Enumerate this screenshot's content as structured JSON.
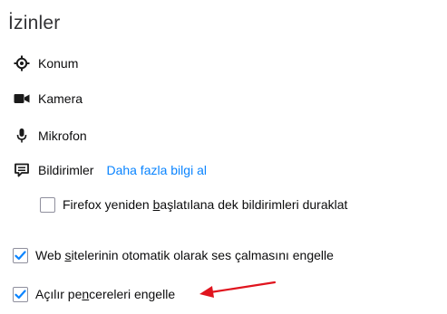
{
  "section": {
    "title": "İzinler"
  },
  "permissions": [
    {
      "label": "Konum",
      "icon": "location-icon"
    },
    {
      "label": "Kamera",
      "icon": "camera-icon"
    },
    {
      "label": "Mikrofon",
      "icon": "microphone-icon"
    },
    {
      "label": "Bildirimler",
      "icon": "notification-icon",
      "link": "Daha fazla bilgi al"
    }
  ],
  "checkboxes": {
    "pause_notifications": {
      "pre": "Firefox yeniden ",
      "accesskey": "b",
      "post": "aşlatılana dek bildirimleri duraklat",
      "checked": false
    },
    "block_autoplay": {
      "pre": "Web ",
      "accesskey": "s",
      "post": "itelerinin otomatik olarak ses çalmasını engelle",
      "checked": true
    },
    "block_popups": {
      "pre": "Açılır pe",
      "accesskey": "n",
      "post": "cereleri engelle",
      "checked": true
    }
  },
  "colors": {
    "link": "#0a84ff",
    "checkmark": "#0a84ff",
    "annotation_arrow": "#e0141e"
  }
}
